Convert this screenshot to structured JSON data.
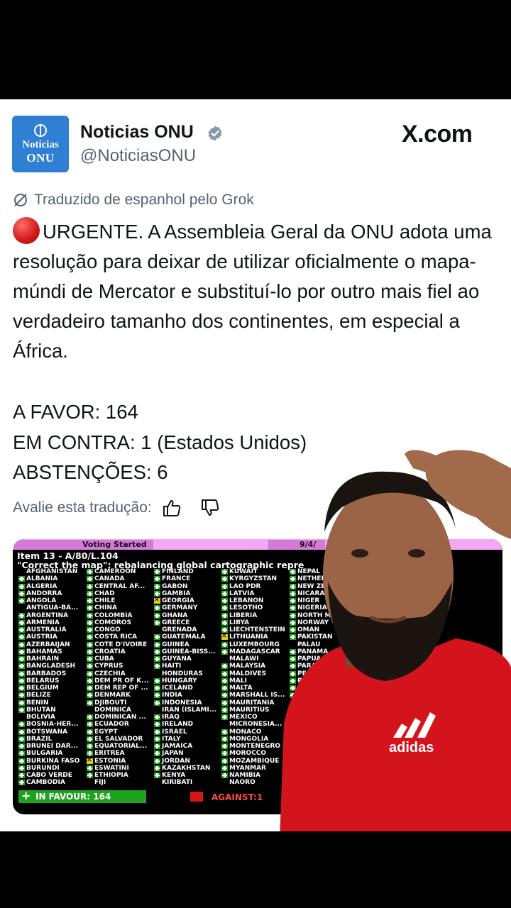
{
  "account": {
    "avatar_line1": "Noticias",
    "avatar_line2": "ONU",
    "name": "Noticias ONU",
    "handle": "@NoticiasONU",
    "site": "X.com",
    "verified_color": "#829aab"
  },
  "translation_note": "Traduzido de espanhol pelo Grok",
  "post": {
    "headline": "URGENTE. A Assembleia Geral da ONU adota uma resolução para deixar de utilizar oficialmente o mapa-múndi de Mercator e substituí-lo por outro mais fiel ao verdadeiro tamanho dos continentes, em especial a África.",
    "stat_favor": "A FAVOR: 164",
    "stat_contra": "EM CONTRA: 1 (Estados Unidos)",
    "stat_abst": "ABSTENÇÕES: 6"
  },
  "rate": {
    "label": "Avalie esta tradução:",
    "thumbs_up_icon": "thumbs-up-icon",
    "thumbs_down_icon": "thumbs-down-icon"
  },
  "vote_board": {
    "header": "Voting Started",
    "date": "9/4/",
    "item": "Item 13 - A/80/L.104",
    "subtitle": "\"Correct the map\": rebalancing global cartographic repre",
    "columns": [
      [
        [
          "",
          "AFGHANISTAN"
        ],
        [
          "y",
          "ALBANIA"
        ],
        [
          "y",
          "ALGERIA"
        ],
        [
          "y",
          "ANDORRA"
        ],
        [
          "y",
          "ANGOLA"
        ],
        [
          "",
          "ANTIGUA-BA..."
        ],
        [
          "y",
          "ARGENTINA"
        ],
        [
          "y",
          "ARMENIA"
        ],
        [
          "y",
          "AUSTRALIA"
        ],
        [
          "y",
          "AUSTRIA"
        ],
        [
          "y",
          "AZERBAIJAN"
        ],
        [
          "y",
          "BAHAMAS"
        ],
        [
          "y",
          "BAHRAIN"
        ],
        [
          "y",
          "BANGLADESH"
        ],
        [
          "y",
          "BARBADOS"
        ],
        [
          "y",
          "BELARUS"
        ],
        [
          "y",
          "BELGIUM"
        ],
        [
          "y",
          "BELIZE"
        ],
        [
          "y",
          "BENIN"
        ],
        [
          "y",
          "BHUTAN"
        ],
        [
          "",
          "BOLIVIA"
        ],
        [
          "y",
          "BOSNIA-HER..."
        ],
        [
          "y",
          "BOTSWANA"
        ],
        [
          "y",
          "BRAZIL"
        ],
        [
          "y",
          "BRUNEI DAR..."
        ],
        [
          "y",
          "BULGARIA"
        ],
        [
          "y",
          "BURKINA FASO"
        ],
        [
          "y",
          "BURUNDI"
        ],
        [
          "y",
          "CABO VERDE"
        ],
        [
          "y",
          "CAMBODIA"
        ]
      ],
      [
        [
          "y",
          "CAMEROON"
        ],
        [
          "y",
          "CANADA"
        ],
        [
          "y",
          "CENTRAL AF..."
        ],
        [
          "y",
          "CHAD"
        ],
        [
          "y",
          "CHILE"
        ],
        [
          "y",
          "CHINA"
        ],
        [
          "y",
          "COLOMBIA"
        ],
        [
          "y",
          "COMOROS"
        ],
        [
          "y",
          "CONGO"
        ],
        [
          "y",
          "COSTA RICA"
        ],
        [
          "y",
          "COTE D'IVOIRE"
        ],
        [
          "y",
          "CROATIA"
        ],
        [
          "y",
          "CUBA"
        ],
        [
          "y",
          "CYPRUS"
        ],
        [
          "y",
          "CZECHIA"
        ],
        [
          "y",
          "DEM PR OF K..."
        ],
        [
          "y",
          "DEM REP OF ..."
        ],
        [
          "y",
          "DENMARK"
        ],
        [
          "y",
          "DJIBOUTI"
        ],
        [
          "",
          "DOMINICA"
        ],
        [
          "y",
          "DOMINICAN ..."
        ],
        [
          "y",
          "ECUADOR"
        ],
        [
          "y",
          "EGYPT"
        ],
        [
          "y",
          "EL SALVADOR"
        ],
        [
          "y",
          "EQUATORIAL..."
        ],
        [
          "y",
          "ERITREA"
        ],
        [
          "a",
          "ESTONIA"
        ],
        [
          "y",
          "ESWATINI"
        ],
        [
          "y",
          "ETHIOPIA"
        ],
        [
          "",
          "FIJI"
        ]
      ],
      [
        [
          "y",
          "FINLAND"
        ],
        [
          "y",
          "FRANCE"
        ],
        [
          "y",
          "GABON"
        ],
        [
          "y",
          "GAMBIA"
        ],
        [
          "a",
          "GEORGIA"
        ],
        [
          "y",
          "GERMANY"
        ],
        [
          "y",
          "GHANA"
        ],
        [
          "y",
          "GREECE"
        ],
        [
          "",
          "GRENADA"
        ],
        [
          "y",
          "GUATEMALA"
        ],
        [
          "y",
          "GUINEA"
        ],
        [
          "y",
          "GUINEA-BISS..."
        ],
        [
          "y",
          "GUYANA"
        ],
        [
          "y",
          "HAITI"
        ],
        [
          "",
          "HONDURAS"
        ],
        [
          "y",
          "HUNGARY"
        ],
        [
          "y",
          "ICELAND"
        ],
        [
          "y",
          "INDIA"
        ],
        [
          "y",
          "INDONESIA"
        ],
        [
          "",
          "IRAN (ISLAMI..."
        ],
        [
          "y",
          "IRAQ"
        ],
        [
          "y",
          "IRELAND"
        ],
        [
          "y",
          "ISRAEL"
        ],
        [
          "y",
          "ITALY"
        ],
        [
          "y",
          "JAMAICA"
        ],
        [
          "y",
          "JAPAN"
        ],
        [
          "y",
          "JORDAN"
        ],
        [
          "y",
          "KAZAKHSTAN"
        ],
        [
          "y",
          "KENYA"
        ],
        [
          "",
          "KIRIBATI"
        ]
      ],
      [
        [
          "y",
          "KUWAIT"
        ],
        [
          "y",
          "KYRGYZSTAN"
        ],
        [
          "y",
          "LAO PDR"
        ],
        [
          "y",
          "LATVIA"
        ],
        [
          "y",
          "LEBANON"
        ],
        [
          "y",
          "LESOTHO"
        ],
        [
          "y",
          "LIBERIA"
        ],
        [
          "y",
          "LIBYA"
        ],
        [
          "y",
          "LIECHTENSTEIN"
        ],
        [
          "a",
          "LITHUANIA"
        ],
        [
          "y",
          "LUXEMBOURG"
        ],
        [
          "y",
          "MADAGASCAR"
        ],
        [
          "",
          "MALAWI"
        ],
        [
          "y",
          "MALAYSIA"
        ],
        [
          "y",
          "MALDIVES"
        ],
        [
          "y",
          "MALI"
        ],
        [
          "y",
          "MALTA"
        ],
        [
          "y",
          "MARSHALL IS..."
        ],
        [
          "y",
          "MAURITANIA"
        ],
        [
          "y",
          "MAURITIUS"
        ],
        [
          "y",
          "MEXICO"
        ],
        [
          "",
          "MICRONESIA..."
        ],
        [
          "y",
          "MONACO"
        ],
        [
          "y",
          "MONGOLIA"
        ],
        [
          "y",
          "MONTENEGRO"
        ],
        [
          "y",
          "MOROCCO"
        ],
        [
          "y",
          "MOZAMBIQUE"
        ],
        [
          "y",
          "MYANMAR"
        ],
        [
          "y",
          "NAMIBIA"
        ],
        [
          "",
          "NAORO"
        ]
      ],
      [
        [
          "y",
          "NEPAL"
        ],
        [
          "y",
          "NETHER"
        ],
        [
          "y",
          "NEW ZE"
        ],
        [
          "y",
          "NICARA"
        ],
        [
          "y",
          "NIGER"
        ],
        [
          "y",
          "NIGERIA"
        ],
        [
          "y",
          "NORTH M"
        ],
        [
          "y",
          "NORWAY"
        ],
        [
          "y",
          "OMAN"
        ],
        [
          "y",
          "PAKISTAN"
        ],
        [
          "",
          "PALAU"
        ],
        [
          "y",
          "PANAMA"
        ],
        [
          "y",
          "PAPUA NEW"
        ],
        [
          "y",
          "PARAGUAY"
        ],
        [
          "y",
          "PERU"
        ],
        [
          "y",
          "PHILIPPIN"
        ],
        [
          "y",
          "POLAN"
        ],
        [
          "y",
          "PO"
        ]
      ]
    ],
    "favour": "IN FAVOUR: 164",
    "against": "AGAINST:1",
    "colors": {
      "yes": "#1fa31f",
      "abstain": "#e4c71a",
      "against": "#d91414",
      "header": "#f3a8f3"
    }
  },
  "overlay": {
    "person_shirt_color": "#d4141c",
    "shirt_logo": "adidas-logo"
  }
}
